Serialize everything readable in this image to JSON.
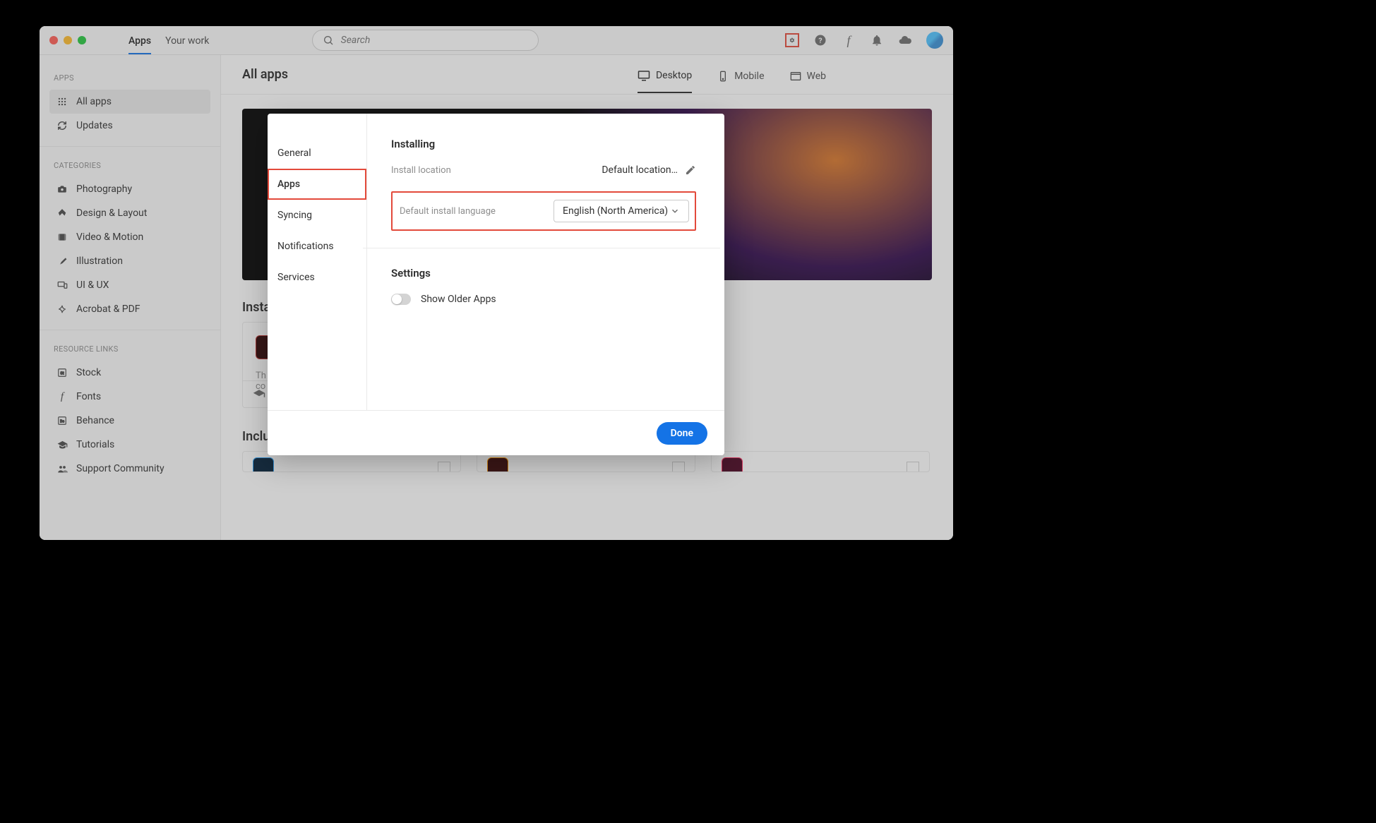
{
  "header": {
    "tabs": {
      "apps": "Apps",
      "your_work": "Your work"
    },
    "search_placeholder": "Search"
  },
  "sidebar": {
    "section_apps": "APPS",
    "items": [
      {
        "label": "All apps"
      },
      {
        "label": "Updates"
      }
    ],
    "section_categories": "CATEGORIES",
    "categories": [
      {
        "label": "Photography"
      },
      {
        "label": "Design & Layout"
      },
      {
        "label": "Video & Motion"
      },
      {
        "label": "Illustration"
      },
      {
        "label": "UI & UX"
      },
      {
        "label": "Acrobat & PDF"
      }
    ],
    "section_resources": "RESOURCE LINKS",
    "resources": [
      {
        "label": "Stock"
      },
      {
        "label": "Fonts"
      },
      {
        "label": "Behance"
      },
      {
        "label": "Tutorials"
      },
      {
        "label": "Support Community"
      }
    ]
  },
  "page": {
    "title": "All apps",
    "tabs": [
      {
        "label": "Desktop"
      },
      {
        "label": "Mobile"
      },
      {
        "label": "Web"
      }
    ],
    "installed_title": "Insta",
    "included_title": "Included in your subscription"
  },
  "prefs": {
    "tabs": {
      "general": "General",
      "apps": "Apps",
      "syncing": "Syncing",
      "notifications": "Notifications",
      "services": "Services"
    },
    "installing_title": "Installing",
    "install_location_label": "Install location",
    "install_location_value": "Default location…",
    "lang_label": "Default install language",
    "lang_value": "English (North America)",
    "settings_title": "Settings",
    "show_older_label": "Show Older Apps",
    "done": "Done"
  }
}
